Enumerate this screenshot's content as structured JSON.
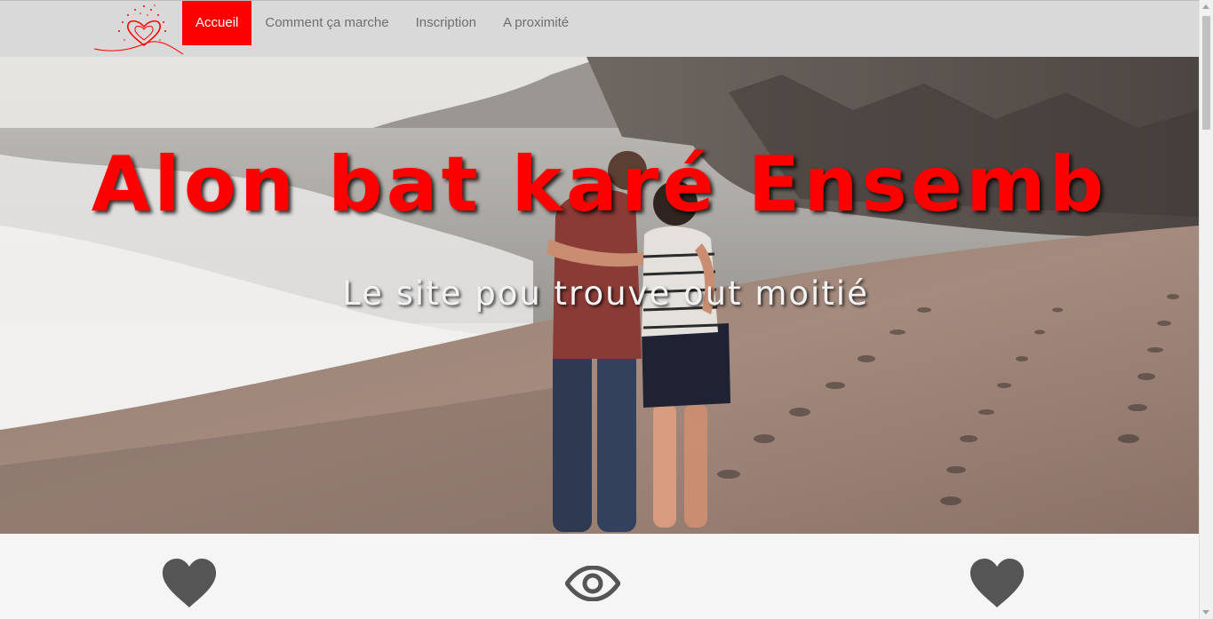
{
  "nav": {
    "items": [
      {
        "label": "Accueil",
        "active": true
      },
      {
        "label": "Comment ça marche",
        "active": false
      },
      {
        "label": "Inscription",
        "active": false
      },
      {
        "label": "A proximité",
        "active": false
      }
    ]
  },
  "hero": {
    "title": "Alon bat karé Ensemb",
    "subtitle": "Le site pou trouve out moitié"
  },
  "features": {
    "icons": [
      "heart-icon",
      "eye-icon",
      "heart-icon"
    ]
  },
  "colors": {
    "accent": "#ff0000",
    "nav_bg": "#d9d9d9",
    "icon": "#555555"
  }
}
